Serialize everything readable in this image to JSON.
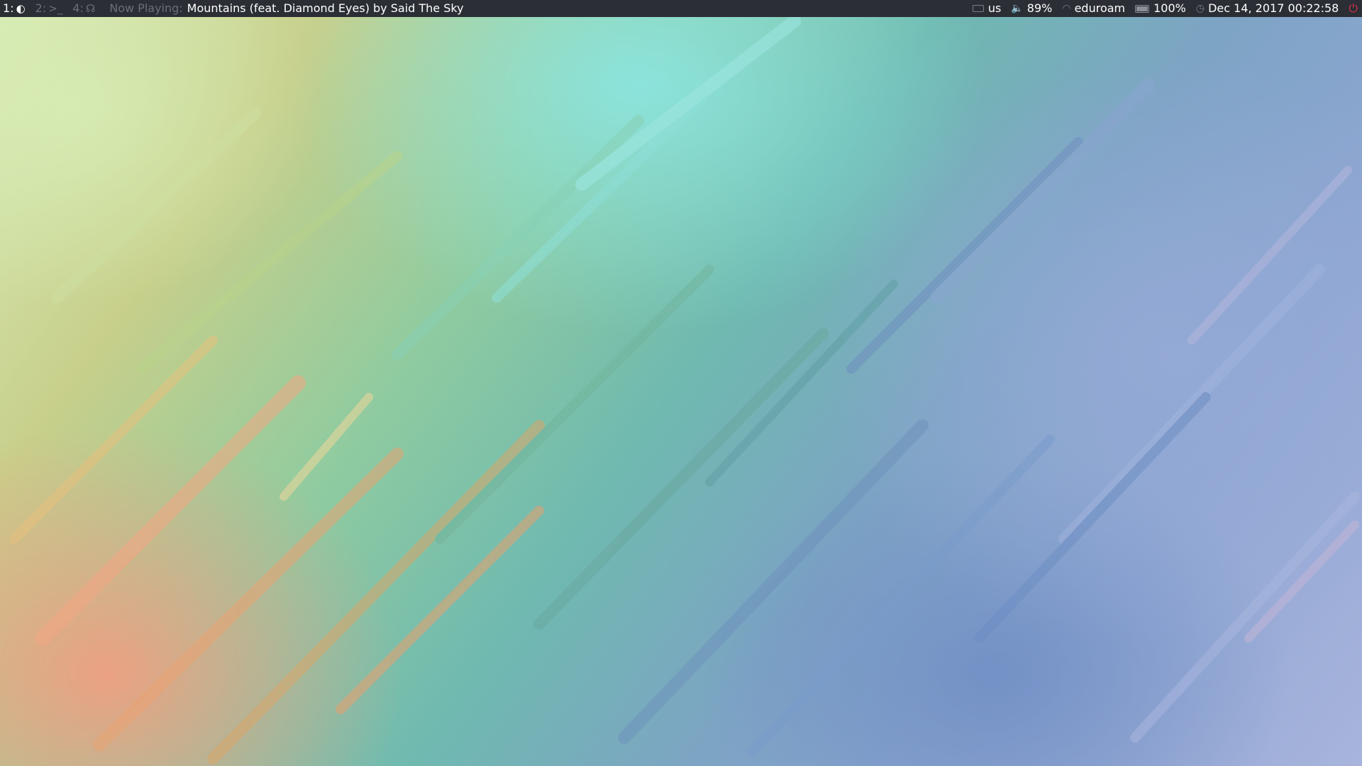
{
  "workspaces": [
    {
      "num": "1:",
      "icon": "firefox-icon",
      "glyph": "◐",
      "active": true
    },
    {
      "num": "2:",
      "icon": "terminal-icon",
      "glyph": ">_",
      "active": false
    },
    {
      "num": "4:",
      "icon": "headphones-icon",
      "glyph": "☊",
      "active": false
    }
  ],
  "now_playing": {
    "label": "Now Playing:",
    "title": "Mountains (feat. Diamond Eyes) by Said The Sky"
  },
  "status": {
    "keyboard_layout": "us",
    "volume": "89%",
    "wifi_ssid": "eduroam",
    "battery": "100%",
    "battery_level": 1.0,
    "datetime": "Dec 14, 2017 00:22:58"
  },
  "icons": {
    "volume": "🔈",
    "wifi": "◠",
    "clock": "◷",
    "power": "⏻"
  },
  "colors": {
    "bar_bg": "#2b2e35",
    "text_active": "#ffffff",
    "text_dim": "#6b6f78",
    "power": "#e0314b"
  }
}
